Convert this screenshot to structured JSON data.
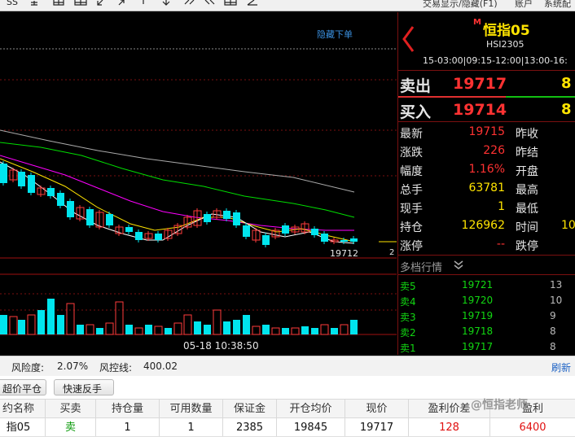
{
  "toolbar": {
    "icons": [
      "chart-type-icon",
      "text-icon",
      "layers-icon",
      "grid-icon",
      "arrow-down-left-icon",
      "arrow-up-right-icon",
      "info-icon",
      "arrow-down-icon",
      "double-left-icon",
      "double-right-icon",
      "table-icon",
      "pen-icon"
    ],
    "menu": [
      "交易显示/隐藏(F1)",
      "账户",
      "系统配"
    ]
  },
  "chart": {
    "hide_order_label": "隐藏下单",
    "last_price_label": "19712",
    "right_edge_label": "2",
    "time_label": "05-18 10:38:50",
    "colors": {
      "up": "#ff3b3b",
      "down": "#00e5ee",
      "ma5": "#ffffff",
      "ma10": "#ffe400",
      "ma20": "#ff00ff",
      "ma60": "#00dd00",
      "ma120": "#aaaaaa"
    }
  },
  "quote": {
    "instrument": "恒指05",
    "code": "HSI2305",
    "sessions": "15-03:00|09:15-12:00|13:00-16:",
    "sell_label": "卖出",
    "sell_price": "19717",
    "sell_qty": "8",
    "buy_label": "买入",
    "buy_price": "19714",
    "buy_qty": "8",
    "stats_left": [
      {
        "label": "最新",
        "value": "19715",
        "color": "red"
      },
      {
        "label": "涨跌",
        "value": "226",
        "color": "red"
      },
      {
        "label": "幅度",
        "value": "1.16%",
        "color": "red"
      },
      {
        "label": "总手",
        "value": "63781",
        "color": "yellow"
      },
      {
        "label": "现手",
        "value": "1",
        "color": "yellow"
      },
      {
        "label": "持仓",
        "value": "126962",
        "color": "yellow"
      },
      {
        "label": "涨停",
        "value": "--",
        "color": "red"
      }
    ],
    "stats_right": [
      {
        "label": "昨收",
        "value": ""
      },
      {
        "label": "昨结",
        "value": ""
      },
      {
        "label": "开盘",
        "value": ""
      },
      {
        "label": "最高",
        "value": ""
      },
      {
        "label": "最低",
        "value": ""
      },
      {
        "label": "时间",
        "value": "10"
      },
      {
        "label": "跌停",
        "value": ""
      }
    ],
    "depth_title": "多档行情",
    "depth": [
      {
        "label": "卖5",
        "price": "19721",
        "qty": "13"
      },
      {
        "label": "卖4",
        "price": "19720",
        "qty": "10"
      },
      {
        "label": "卖3",
        "price": "19719",
        "qty": "9"
      },
      {
        "label": "卖2",
        "price": "19718",
        "qty": "8"
      },
      {
        "label": "卖1",
        "price": "19717",
        "qty": "8"
      }
    ]
  },
  "risk": {
    "risk_label": "风险度:",
    "risk_value": "2.07%",
    "control_label": "风控线:",
    "control_value": "400.02",
    "refresh_label": "刷新"
  },
  "actions": {
    "close_btn": "超价平仓",
    "reverse_btn": "快速反手"
  },
  "positions": {
    "headers": [
      "约名称",
      "买卖",
      "持仓量",
      "可用数量",
      "保证金",
      "开仓均价",
      "现价",
      "盈利价差",
      "盈利"
    ],
    "row": {
      "name": "指05",
      "side": "卖",
      "qty": "1",
      "available": "1",
      "margin": "2385",
      "open_avg": "19845",
      "price": "19717",
      "spread": "128",
      "profit": "6400"
    }
  },
  "watermark": "@恒指老师"
}
